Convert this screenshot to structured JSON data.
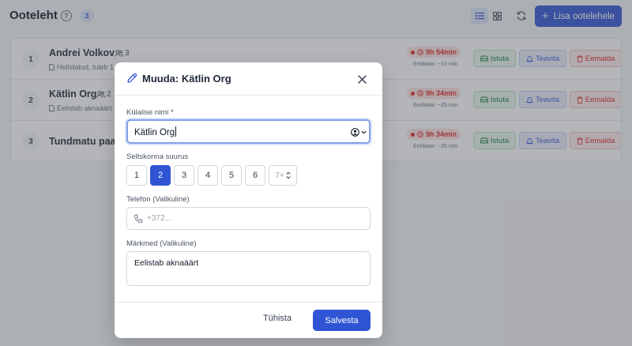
{
  "header": {
    "title": "Ooteleht",
    "help_icon": "?",
    "count": "3",
    "add_label": "Lisa ootelehele"
  },
  "rows": [
    {
      "num": "1",
      "name": "Andrei Volkov",
      "party": "3",
      "note": "Helistatud, tuleb 1",
      "wait": "9h 54min",
      "est": "Eeldatav: ~15 min"
    },
    {
      "num": "2",
      "name": "Kätlin Org",
      "party": "2",
      "note": "Eelistab aknaäärt",
      "wait": "9h 34min",
      "est": "Eeldatav: ~25 min"
    },
    {
      "num": "3",
      "name": "Tundmatu paar",
      "party": "",
      "note": "",
      "wait": "9h 34min",
      "est": "Eeldatav: ~35 min"
    }
  ],
  "row_actions": {
    "seat": "Istuta",
    "notify": "Teavita",
    "remove": "Eemalda"
  },
  "modal": {
    "title": "Muuda: Kätlin Org",
    "name_label": "Külalise nimi *",
    "name_value": "Kätlin Org",
    "party_label": "Seltskonna suurus",
    "party_options": [
      "1",
      "2",
      "3",
      "4",
      "5",
      "6"
    ],
    "party_selected": "2",
    "party_more": "7+",
    "phone_label": "Telefon (Valikuline)",
    "phone_placeholder": "+372...",
    "notes_label": "Märkmed (Valikuline)",
    "notes_value": "Eelistab aknaäärt",
    "cancel_label": "Tühista",
    "save_label": "Salvesta"
  },
  "colors": {
    "primary": "#2f55d4",
    "danger": "#dc2626",
    "success": "#15803d"
  }
}
